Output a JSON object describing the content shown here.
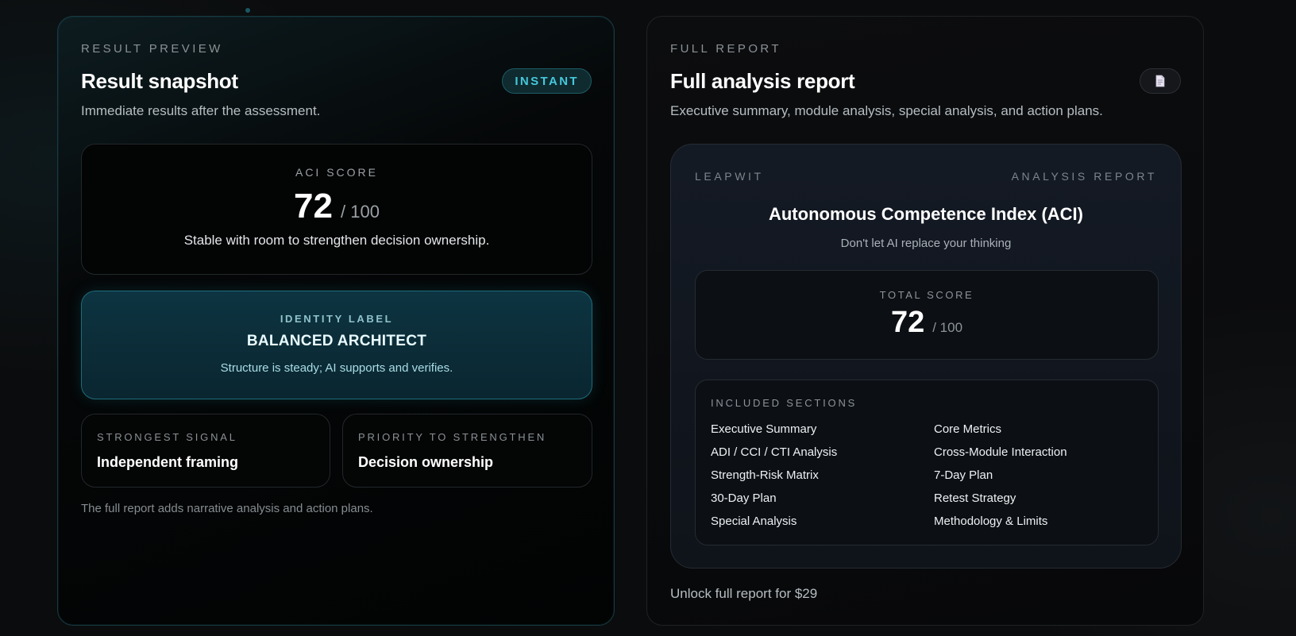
{
  "preview": {
    "eyebrow": "RESULT PREVIEW",
    "title": "Result snapshot",
    "badge": "INSTANT",
    "subtitle": "Immediate results after the assessment.",
    "score": {
      "label": "ACI SCORE",
      "value": "72",
      "denominator": "/ 100",
      "note": "Stable with room to strengthen decision ownership."
    },
    "identity": {
      "label": "IDENTITY LABEL",
      "name": "BALANCED ARCHITECT",
      "desc": "Structure is steady; AI supports and verifies."
    },
    "strongest": {
      "label": "STRONGEST SIGNAL",
      "value": "Independent framing"
    },
    "priority": {
      "label": "PRIORITY TO STRENGTHEN",
      "value": "Decision ownership"
    },
    "footnote": "The full report adds narrative analysis and action plans."
  },
  "full": {
    "eyebrow": "FULL REPORT",
    "title": "Full analysis report",
    "doc_icon": "document-icon",
    "subtitle": "Executive summary, module analysis, special analysis, and action plans.",
    "report": {
      "brand": "LEAPWIT",
      "kind": "ANALYSIS REPORT",
      "title": "Autonomous Competence Index (ACI)",
      "tagline": "Don't let AI replace your thinking",
      "total": {
        "label": "TOTAL SCORE",
        "value": "72",
        "denominator": "/ 100"
      },
      "sections": {
        "label": "INCLUDED SECTIONS",
        "items": [
          "Executive Summary",
          "Core Metrics",
          "ADI / CCI / CTI Analysis",
          "Cross-Module Interaction",
          "Strength-Risk Matrix",
          "7-Day Plan",
          "30-Day Plan",
          "Retest Strategy",
          "Special Analysis",
          "Methodology & Limits"
        ]
      }
    },
    "unlock": "Unlock full report for $29"
  },
  "colors": {
    "accent": "#46c8dc",
    "identity_bg": "#0d3441",
    "background": "#0b0c0d"
  }
}
